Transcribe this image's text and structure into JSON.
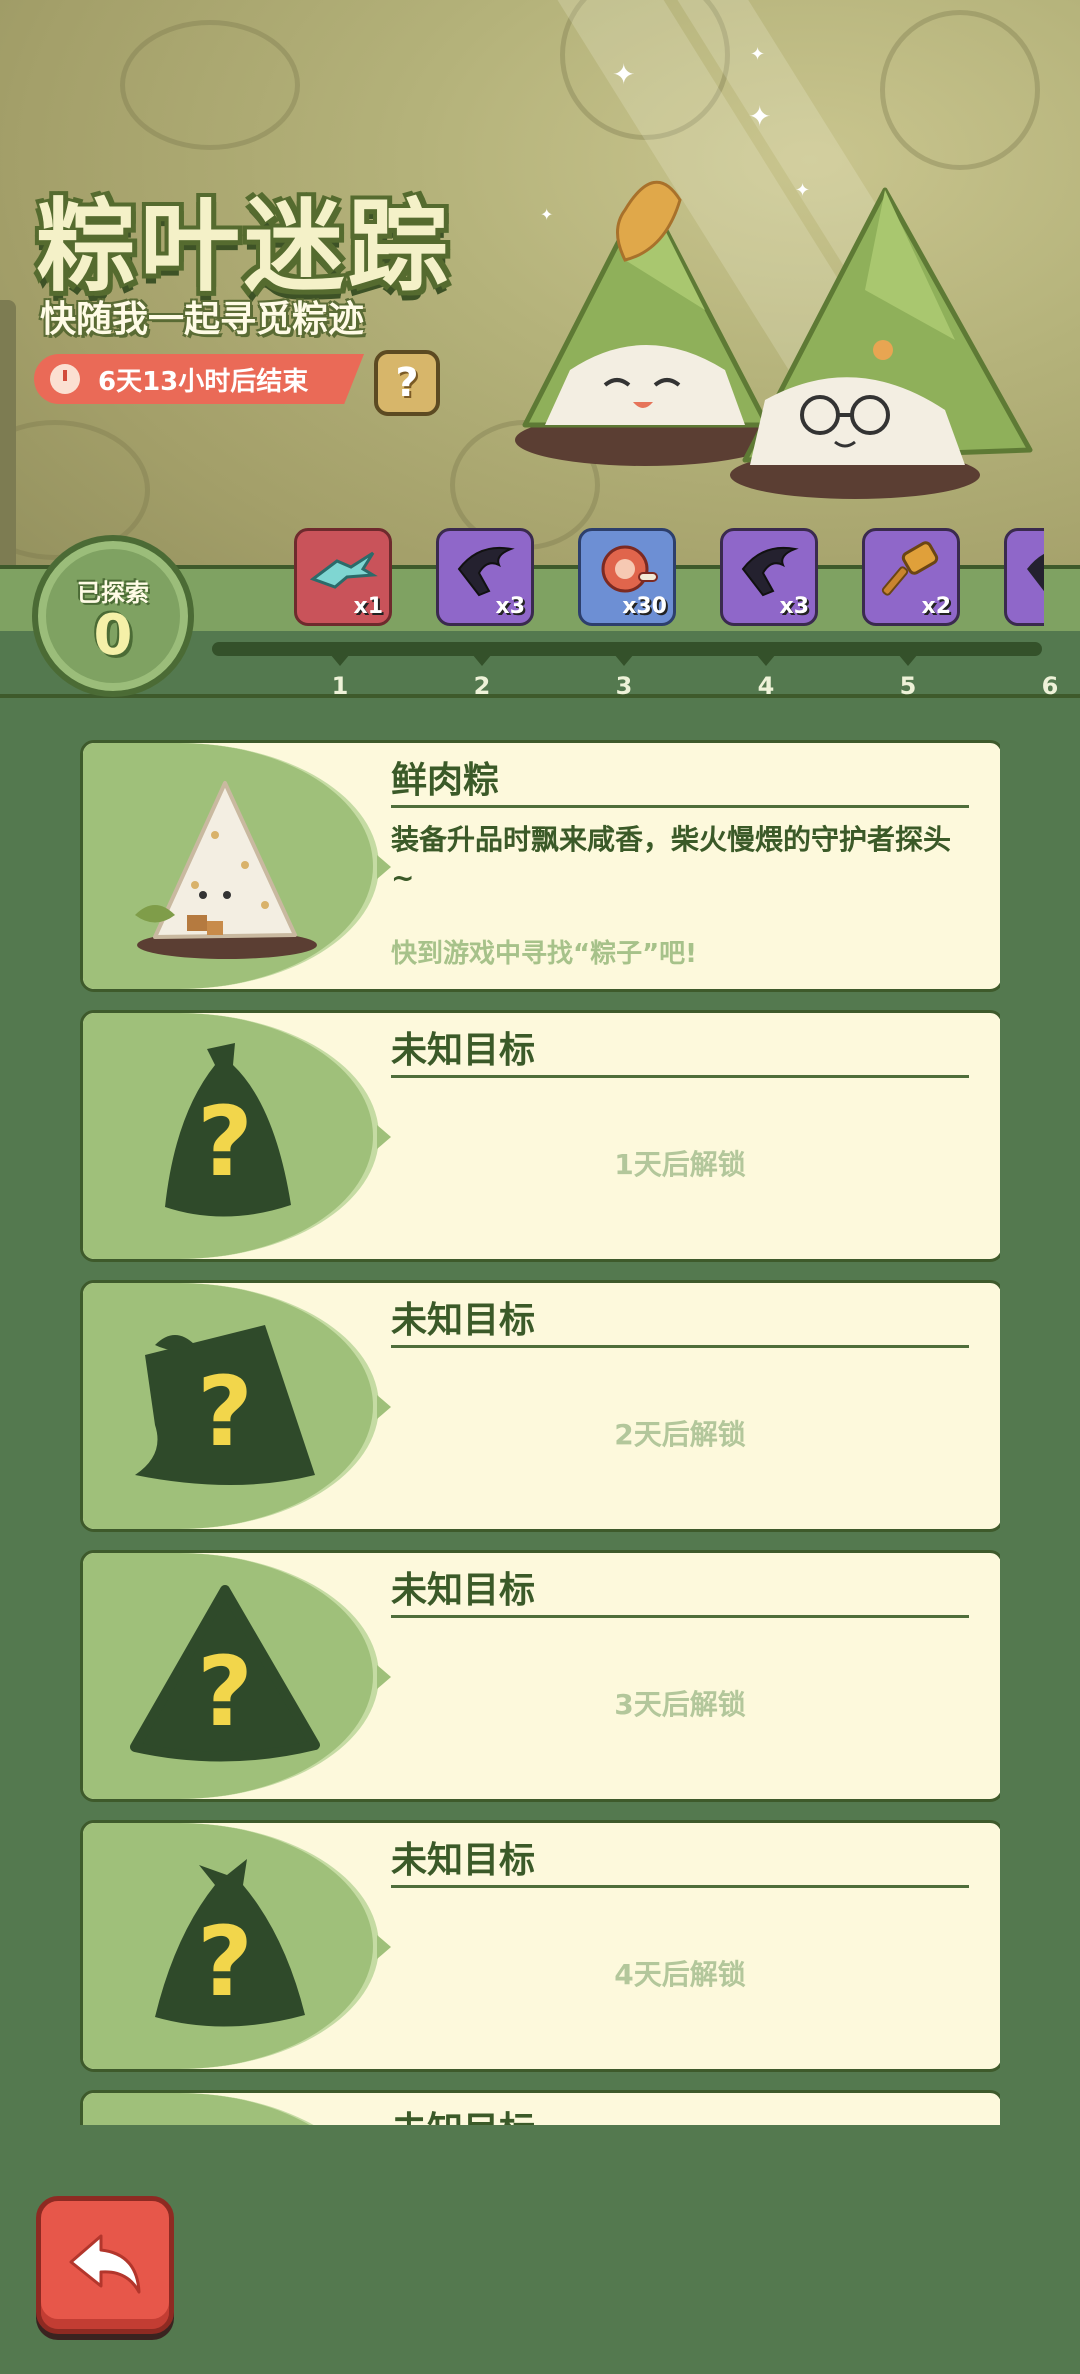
{
  "event": {
    "title": "粽叶迷踪",
    "subtitle": "快随我一起寻觅粽迹",
    "timer_text": "6天13小时后结束",
    "help_label": "?"
  },
  "progress": {
    "explored_label": "已探索",
    "explored_count": "0",
    "rewards": [
      {
        "step": "1",
        "qty": "x1",
        "icon": "teal-dragon-item-icon",
        "color": "#c9535a"
      },
      {
        "step": "2",
        "qty": "x3",
        "icon": "dark-claw-item-icon",
        "color": "#8f67c9"
      },
      {
        "step": "3",
        "qty": "x30",
        "icon": "ham-meat-icon",
        "color": "#6d8fd4"
      },
      {
        "step": "4",
        "qty": "x3",
        "icon": "dark-claw-item-icon",
        "color": "#8f67c9"
      },
      {
        "step": "5",
        "qty": "x2",
        "icon": "hammer-icon",
        "color": "#8f67c9"
      },
      {
        "step": "6",
        "qty": "",
        "icon": "dark-claw-item-icon",
        "color": "#8f67c9"
      }
    ]
  },
  "cards": [
    {
      "title": "鲜肉粽",
      "desc": "装备升品时飘来咸香，柴火慢煨的守护者探头~",
      "hint": "快到游戏中寻找“粽子”吧!",
      "icon": "meat-zongzi-icon"
    },
    {
      "title": "未知目标",
      "unlock": "1天后解锁",
      "icon": "mystery-zongzi-silhouette-icon"
    },
    {
      "title": "未知目标",
      "unlock": "2天后解锁",
      "icon": "mystery-zongzi-silhouette-icon"
    },
    {
      "title": "未知目标",
      "unlock": "3天后解锁",
      "icon": "mystery-zongzi-silhouette-icon"
    },
    {
      "title": "未知目标",
      "unlock": "4天后解锁",
      "icon": "mystery-zongzi-silhouette-icon"
    },
    {
      "title": "未知目标",
      "unlock": "",
      "icon": "mystery-zongzi-silhouette-icon"
    }
  ],
  "colors": {
    "background": "#54794f",
    "card": "#fdf9dc",
    "card_left": "#9fc07a",
    "text_dark_green": "#3b5a28",
    "timer_red": "#ea6a57",
    "question_yellow": "#f2d64b"
  },
  "back_icon": "back-arrow-icon"
}
